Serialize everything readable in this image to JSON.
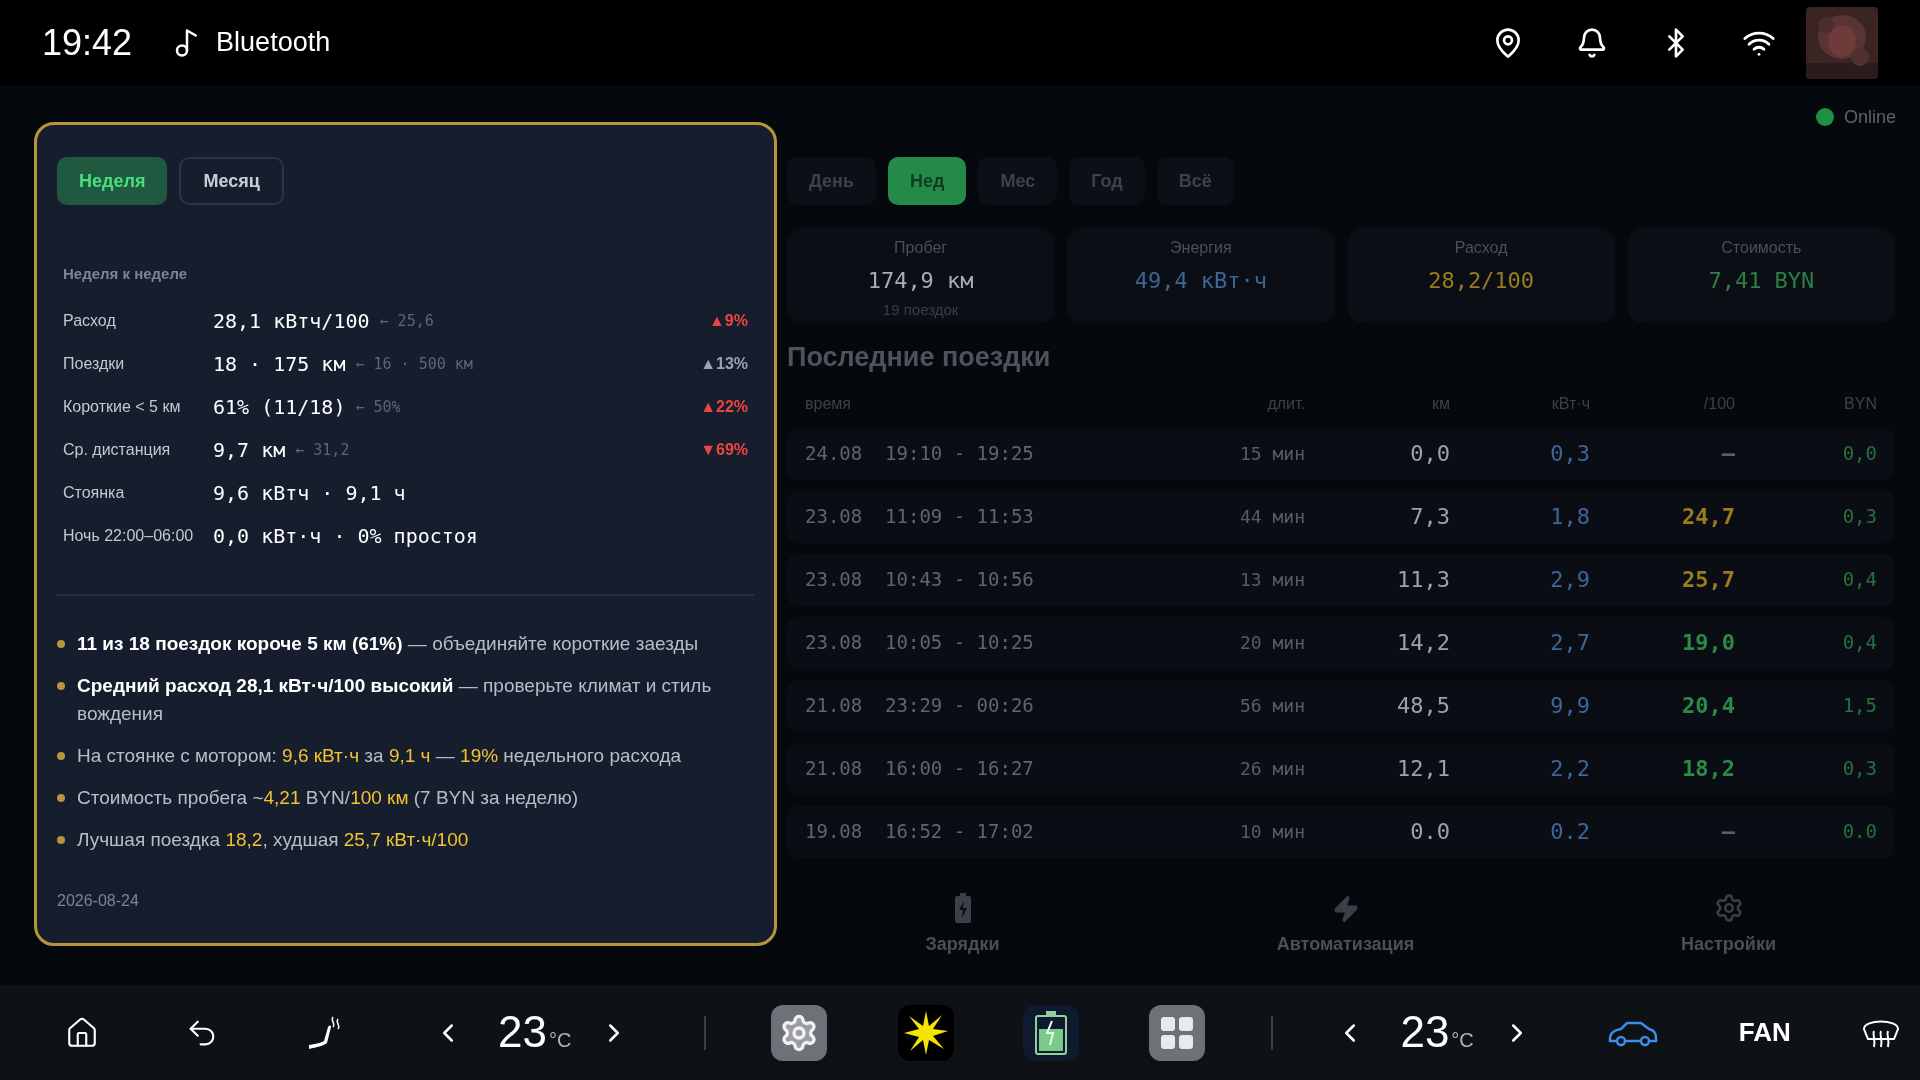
{
  "status_bar": {
    "time": "19:42",
    "media_label": "Bluetooth"
  },
  "app": {
    "connection": {
      "label": "Online",
      "color": "#1f8f45"
    }
  },
  "periods": [
    {
      "label": "День",
      "selected": false
    },
    {
      "label": "Нед",
      "selected": true
    },
    {
      "label": "Мес",
      "selected": false
    },
    {
      "label": "Год",
      "selected": false
    },
    {
      "label": "Всё",
      "selected": false
    }
  ],
  "stats": [
    {
      "label": "Пробег",
      "value": "174,9 км",
      "sub": "19 поездок",
      "color": "#a9adb3"
    },
    {
      "label": "Энергия",
      "value": "49,4 кВт·ч",
      "color": "#3d6596"
    },
    {
      "label": "Расход",
      "value": "28,2/100",
      "color": "#9a7b1f"
    },
    {
      "label": "Стоимость",
      "value": "7,41 BYN",
      "color": "#2c7f45"
    }
  ],
  "trips": {
    "title": "Последние поездки",
    "columns": [
      "время",
      "длит.",
      "км",
      "кВт·ч",
      "/100",
      "BYN"
    ],
    "rows": [
      {
        "when": "24.08  19:10 - 19:25",
        "duration": "15 мин",
        "km": "0,0",
        "kwh": "0,3",
        "per100": {
          "text": "—",
          "color": "#5a6068"
        },
        "byn": "0,0"
      },
      {
        "when": "23.08  11:09 - 11:53",
        "duration": "44 мин",
        "km": "7,3",
        "kwh": "1,8",
        "per100": {
          "text": "24,7",
          "color": "#9a7b1f"
        },
        "byn": "0,3"
      },
      {
        "when": "23.08  10:43 - 10:56",
        "duration": "13 мин",
        "km": "11,3",
        "kwh": "2,9",
        "per100": {
          "text": "25,7",
          "color": "#9a7b1f"
        },
        "byn": "0,4"
      },
      {
        "when": "23.08  10:05 - 10:25",
        "duration": "20 мин",
        "km": "14,2",
        "kwh": "2,7",
        "per100": {
          "text": "19,0",
          "color": "#2c8a48"
        },
        "byn": "0,4"
      },
      {
        "when": "21.08  23:29 - 00:26",
        "duration": "56 мин",
        "km": "48,5",
        "kwh": "9,9",
        "per100": {
          "text": "20,4",
          "color": "#2c8a48"
        },
        "byn": "1,5"
      },
      {
        "when": "21.08  16:00 - 16:27",
        "duration": "26 мин",
        "km": "12,1",
        "kwh": "2,2",
        "per100": {
          "text": "18,2",
          "color": "#2c8a48"
        },
        "byn": "0,3"
      },
      {
        "when": "19.08  16:52 - 17:02",
        "duration": "10 мин",
        "km": "0.0",
        "kwh": "0.2",
        "per100": {
          "text": "—",
          "color": "#5a6068"
        },
        "byn": "0.0"
      }
    ]
  },
  "nav": [
    {
      "label": "Зарядки",
      "kind": "charging"
    },
    {
      "label": "Автоматизация",
      "kind": "automation"
    },
    {
      "label": "Настройки",
      "kind": "settings"
    }
  ],
  "report": {
    "tabs": [
      {
        "label": "Неделя",
        "selected": true
      },
      {
        "label": "Месяц",
        "selected": false
      }
    ],
    "section_title": "Неделя к неделе",
    "metrics": [
      {
        "label": "Расход",
        "value": "28,1 кВтч/100",
        "previous": "← 25,6",
        "delta": {
          "text": "▲9%",
          "color": "#ef4444"
        }
      },
      {
        "label": "Поездки",
        "value": "18 · 175 км",
        "previous": "← 16 · 500 км",
        "delta": {
          "text": "▲13%",
          "color": "#9aa3b2"
        }
      },
      {
        "label": "Короткие < 5 км",
        "value": "61% (11/18)",
        "previous": "← 50%",
        "delta": {
          "text": "▲22%",
          "color": "#ef4444"
        }
      },
      {
        "label": "Ср. дистанция",
        "value": "9,7 км",
        "previous": "← 31,2",
        "delta": {
          "text": "▼69%",
          "color": "#ef4444"
        }
      },
      {
        "label": "Стоянка",
        "value": "9,6 кВтч · 9,1 ч"
      },
      {
        "label": "Ночь 22:00–06:00",
        "value": "0,0 кВт·ч · 0% простоя"
      }
    ],
    "tips": [
      {
        "segments": [
          {
            "text": "**11 из 18 поездок короче 5 км (61%)**",
            "color": "#ffffff"
          },
          {
            "text": " — объединяйте короткие заезды",
            "color": "#b7bdc8"
          }
        ]
      },
      {
        "segments": [
          {
            "text": "**Средний расход 28,1 кВт·ч/100 высокий**",
            "color": "#ffffff"
          },
          {
            "text": " — проверьте климат и стиль вождения",
            "color": "#b7bdc8"
          }
        ]
      },
      {
        "segments": [
          {
            "text": "На стоянке с мотором: ",
            "color": "#b7bdc8"
          },
          {
            "text": "9,6 кВт·ч",
            "color": "#f2c230"
          },
          {
            "text": " за ",
            "color": "#b7bdc8"
          },
          {
            "text": "9,1 ч",
            "color": "#f2c230"
          },
          {
            "text": " — ",
            "color": "#b7bdc8"
          },
          {
            "text": "19%",
            "color": "#f2c230"
          },
          {
            "text": " недельного расхода",
            "color": "#b7bdc8"
          }
        ]
      },
      {
        "segments": [
          {
            "text": "Стоимость пробега ~",
            "color": "#b7bdc8"
          },
          {
            "text": "4,21",
            "color": "#f2c230"
          },
          {
            "text": " BYN/",
            "color": "#b7bdc8"
          },
          {
            "text": "100 км",
            "color": "#f2c230"
          },
          {
            "text": " (7 BYN за неделю)",
            "color": "#b7bdc8"
          }
        ]
      },
      {
        "segments": [
          {
            "text": "Лучшая поездка ",
            "color": "#b7bdc8"
          },
          {
            "text": "18,2",
            "color": "#f2c230"
          },
          {
            "text": ", худшая ",
            "color": "#b7bdc8"
          },
          {
            "text": "25,7 кВт·ч/100",
            "color": "#f2c230"
          }
        ]
      }
    ],
    "date": "2026-08-24"
  },
  "climate": {
    "left_temp": {
      "value": "23",
      "unit": "°C"
    },
    "right_temp": {
      "value": "23",
      "unit": "°C"
    },
    "fan_label": "FAN"
  }
}
